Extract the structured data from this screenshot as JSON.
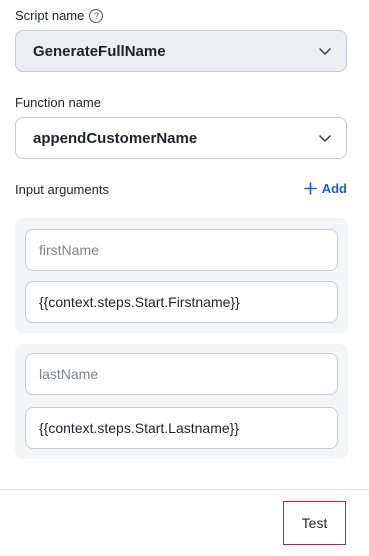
{
  "script_name": {
    "label": "Script name",
    "help_icon": "?",
    "value": "GenerateFullName"
  },
  "function_name": {
    "label": "Function name",
    "value": "appendCustomerName"
  },
  "input_arguments": {
    "label": "Input arguments",
    "add_label": "Add",
    "items": [
      {
        "name": "firstName",
        "value": "{{context.steps.Start.Firstname}}"
      },
      {
        "name": "lastName",
        "value": "{{context.steps.Start.Lastname}}"
      }
    ]
  },
  "footer": {
    "test_label": "Test"
  },
  "colors": {
    "accent": "#1f5bd8",
    "highlight_border": "#d81b2a"
  },
  "icons": {
    "help": "help-circle-icon",
    "chevron": "chevron-down-icon",
    "add": "plus-icon"
  }
}
